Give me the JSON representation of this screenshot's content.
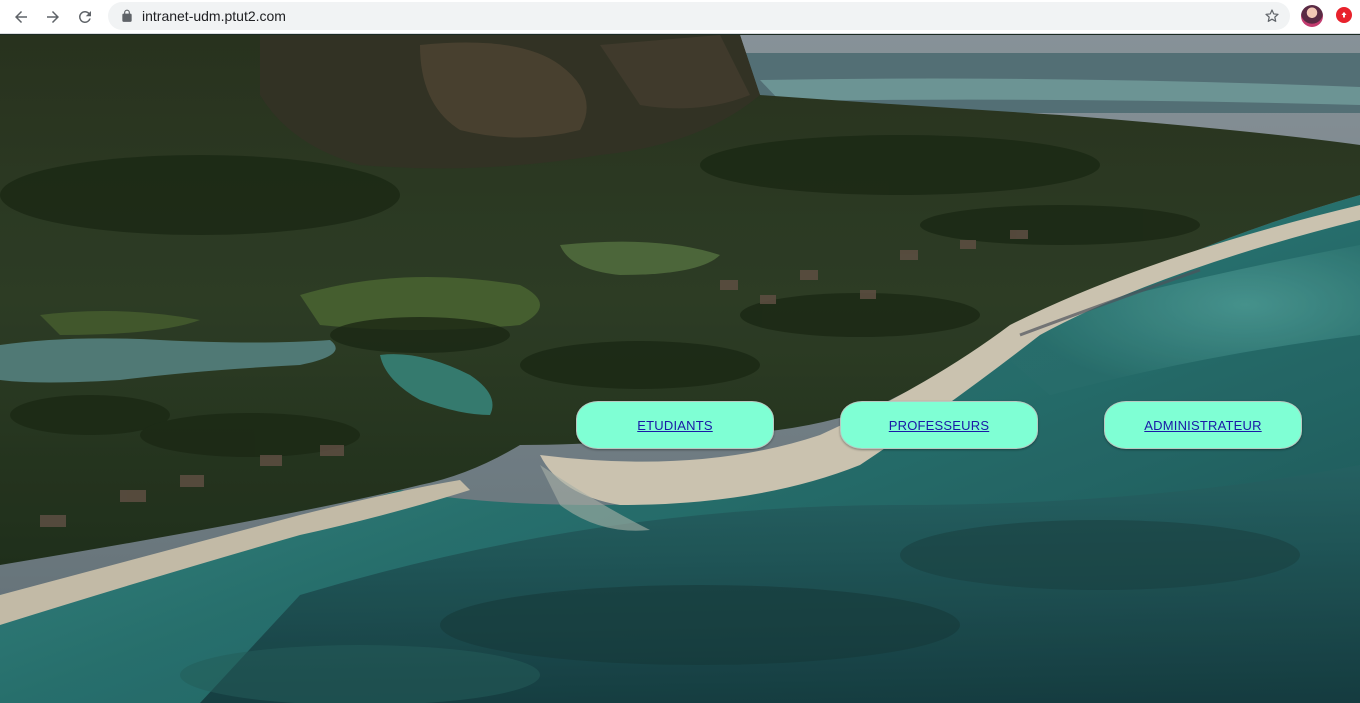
{
  "browser": {
    "url": "intranet-udm.ptut2.com",
    "icons": {
      "back": "arrow-left-icon",
      "forward": "arrow-right-icon",
      "reload": "reload-icon",
      "lock": "lock-icon",
      "bookmark": "star-icon",
      "profile": "avatar",
      "extension": "extension-icon"
    }
  },
  "roles": {
    "students": "ETUDIANTS",
    "professors": "PROFESSEURS",
    "admin": "ADMINISTRATEUR"
  },
  "colors": {
    "button_bg": "#7fffd4",
    "link": "#1a1aa6"
  }
}
